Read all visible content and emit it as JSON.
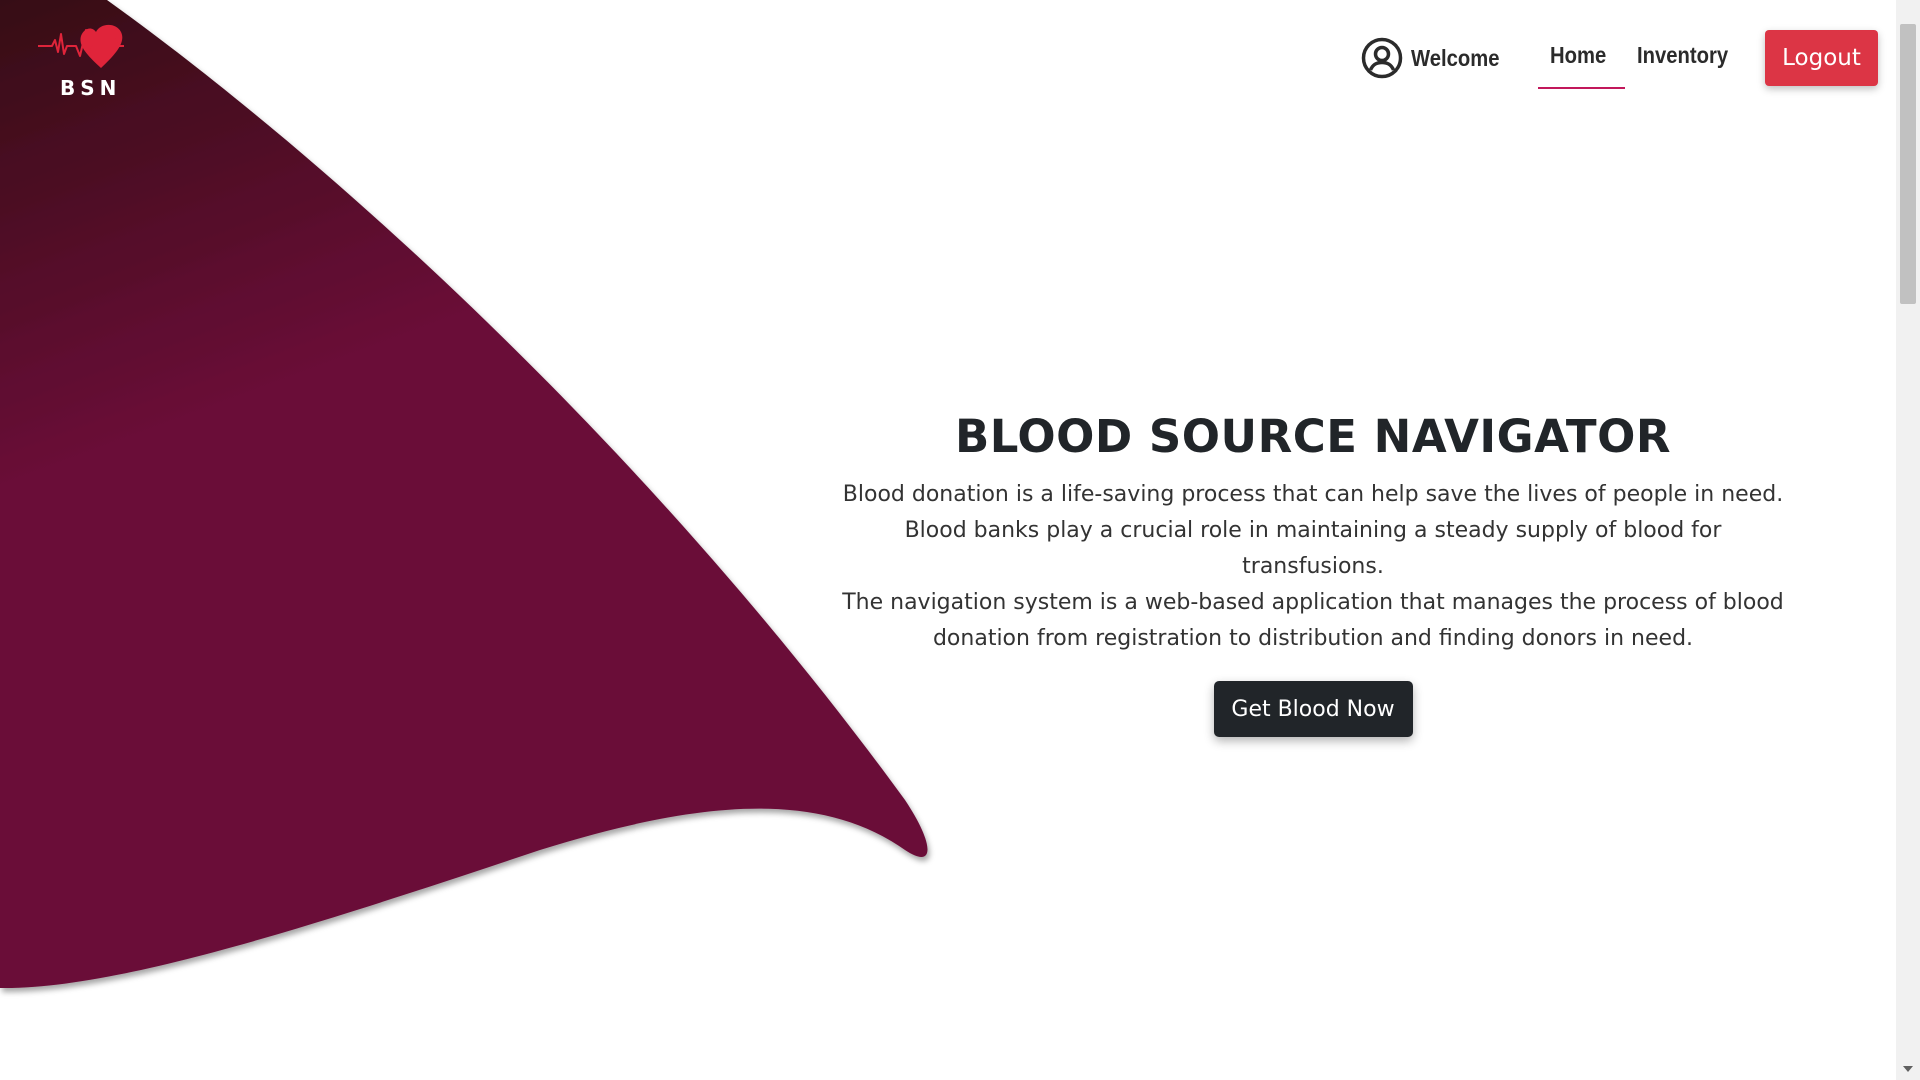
{
  "brand": {
    "logo_text": "BSN",
    "accent_color": "#e0243a",
    "wave_color_dark": "#3b0a19",
    "wave_color": "#6b0b38"
  },
  "nav": {
    "welcome_label": "Welcome",
    "links": [
      {
        "label": "Home",
        "active": true
      },
      {
        "label": "Inventory",
        "active": false
      }
    ],
    "logout_label": "Logout",
    "logout_color": "#dc3545"
  },
  "hero": {
    "title": "BLOOD SOURCE NAVIGATOR",
    "description_lines": [
      "Blood donation is a life-saving process that can help save the lives of people in need.",
      "Blood banks play a crucial role in maintaining a steady supply of blood for transfusions.",
      "The navigation system is a web-based application that manages the process of blood",
      "donation from registration to distribution and finding donors in need."
    ],
    "cta_label": "Get Blood Now"
  },
  "icons": {
    "logo": "heart-pulse-icon",
    "user": "user-circle-icon"
  }
}
